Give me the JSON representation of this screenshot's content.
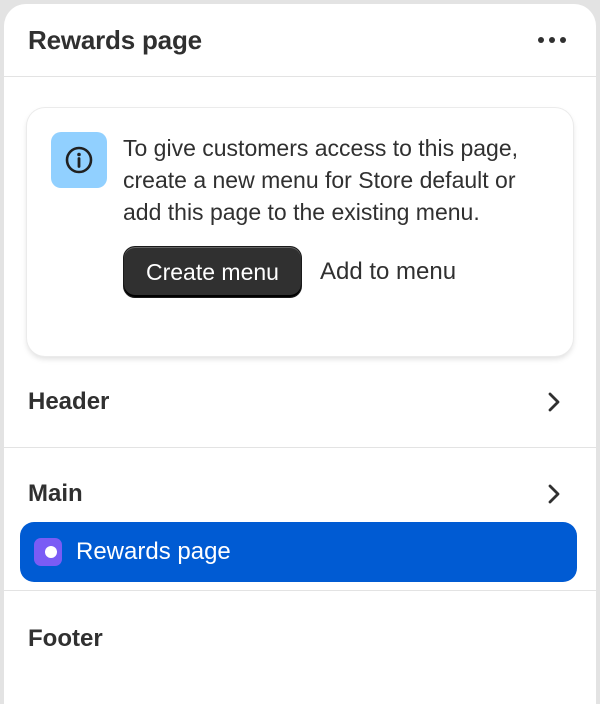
{
  "panel": {
    "title": "Rewards page",
    "more_icon": "more-horizontal-icon"
  },
  "banner": {
    "icon": "info-icon",
    "message": "To give customers access to this page, create a new menu for Store default or add this page to the existing menu.",
    "primary_action": "Create menu",
    "secondary_action": "Add to menu"
  },
  "sections": {
    "header": {
      "label": "Header",
      "icon": "chevron-right-icon"
    },
    "main": {
      "label": "Main",
      "icon": "chevron-right-icon",
      "selected_item": {
        "label": "Rewards page",
        "icon": "toggle-icon"
      }
    },
    "footer": {
      "label": "Footer"
    }
  },
  "colors": {
    "selected_bg": "#005bd3",
    "info_icon_bg": "#91d0ff",
    "primary_button": "#303030",
    "toggle_icon": "#7a5cf5"
  }
}
